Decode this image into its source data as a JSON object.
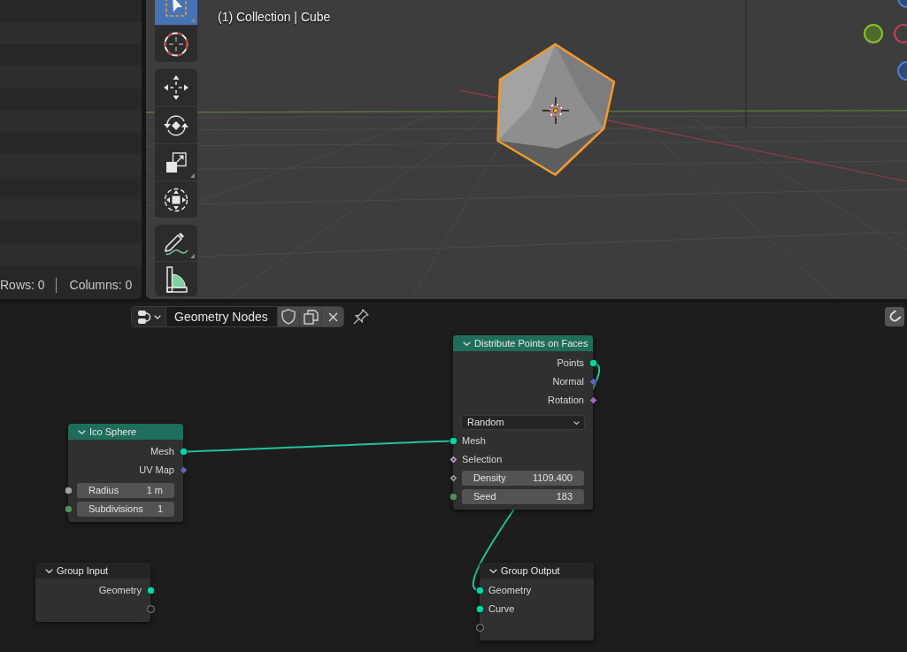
{
  "spreadsheet": {
    "rows_count": "Rows: 0",
    "columns_count": "Columns: 0"
  },
  "viewport": {
    "info": "(1) Collection | Cube",
    "tool_groups": [
      {
        "tools": [
          {
            "kind": "select_box",
            "selected": true,
            "more_tools": true
          },
          {
            "kind": "cursor",
            "selected": false,
            "more_tools": false
          }
        ]
      },
      {
        "tools": [
          {
            "kind": "move",
            "selected": false,
            "more_tools": false
          },
          {
            "kind": "rotate",
            "selected": false,
            "more_tools": false
          },
          {
            "kind": "scale",
            "selected": false,
            "more_tools": true
          },
          {
            "kind": "transform",
            "selected": false,
            "more_tools": false
          }
        ]
      },
      {
        "tools": [
          {
            "kind": "annotate",
            "selected": false,
            "more_tools": true
          },
          {
            "kind": "measure",
            "selected": false,
            "more_tools": false
          }
        ]
      }
    ]
  },
  "node_editor": {
    "tree_name": "Geometry Nodes",
    "nodes": [
      {
        "title": "Distribute Points on Faces",
        "kind": "geometry",
        "rows": [
          {
            "kind": "output",
            "label": "Points",
            "socket": {
              "kind": "circle",
              "color": "#00d6a3"
            }
          },
          {
            "kind": "output",
            "label": "Normal",
            "socket": {
              "kind": "diamond",
              "color": "#6363c7"
            }
          },
          {
            "kind": "output",
            "label": "Rotation",
            "socket": {
              "kind": "diamond",
              "color": "#a663c7"
            }
          },
          {
            "kind": "dropdown",
            "value": "Random"
          },
          {
            "kind": "input",
            "label": "Mesh",
            "socket": {
              "kind": "circle",
              "color": "#00d6a3"
            }
          },
          {
            "kind": "input",
            "label": "Selection",
            "socket": {
              "kind": "diamond_dot",
              "color": "#cca6d6"
            }
          },
          {
            "kind": "field",
            "label": "Density",
            "value": "1109.400",
            "socket": {
              "kind": "diamond_dot",
              "color": "#a1a1a1"
            }
          },
          {
            "kind": "field",
            "label": "Seed",
            "value": "183",
            "socket": {
              "kind": "circle",
              "color": "#598c5c"
            }
          }
        ]
      },
      {
        "title": "Ico Sphere",
        "kind": "geometry",
        "rows": [
          {
            "kind": "output",
            "label": "Mesh",
            "socket": {
              "kind": "circle",
              "color": "#00d6a3"
            }
          },
          {
            "kind": "output",
            "label": "UV Map",
            "socket": {
              "kind": "diamond",
              "color": "#6363c7"
            }
          },
          {
            "kind": "field",
            "label": "Radius",
            "value": "1 m",
            "socket": {
              "kind": "circle",
              "color": "#a1a1a1"
            }
          },
          {
            "kind": "field",
            "label": "Subdivisions",
            "value": "1",
            "socket": {
              "kind": "circle",
              "color": "#598c5c"
            }
          }
        ]
      },
      {
        "title": "Group Input",
        "kind": "group",
        "rows": [
          {
            "kind": "output",
            "label": "Geometry",
            "socket": {
              "kind": "circle",
              "color": "#00d6a3"
            }
          },
          {
            "kind": "output",
            "socket": {
              "kind": "empty"
            }
          }
        ]
      },
      {
        "title": "Group Output",
        "kind": "group",
        "rows": [
          {
            "kind": "input",
            "label": "Geometry",
            "socket": {
              "kind": "circle",
              "color": "#00d6a3"
            }
          },
          {
            "kind": "input",
            "label": "Curve",
            "socket": {
              "kind": "circle",
              "color": "#00d6a3"
            }
          },
          {
            "kind": "input",
            "socket": {
              "kind": "empty"
            }
          }
        ]
      }
    ]
  }
}
